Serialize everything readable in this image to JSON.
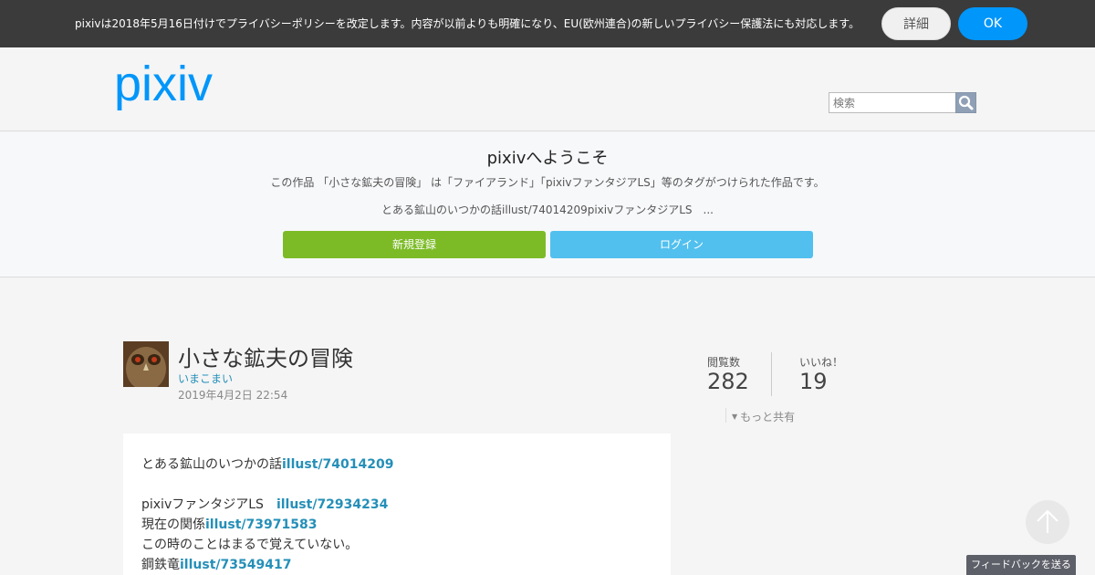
{
  "cookie_bar": {
    "text": "pixivは2018年5月16日付けでプライバシーポリシーを改定します。内容が以前よりも明確になり、EU(欧州連合)の新しいプライバシー保護法にも対応します。",
    "detail_label": "詳細",
    "ok_label": "OK"
  },
  "header": {
    "logo_text": "pixiv",
    "search_placeholder": "検索"
  },
  "welcome": {
    "title": "pixivへようこそ",
    "description": "この作品 「小さな鉱夫の冒険」 は「ファイアランド」「pixivファンタジアLS」等のタグがつけられた作品です。",
    "excerpt": "とある鉱山のいつかの話illust/74014209pixivファンタジアLS　...",
    "signup_label": "新規登録",
    "login_label": "ログイン"
  },
  "work": {
    "title": "小さな鉱夫の冒険",
    "author": "いまこまい",
    "posted": "2019年4月2日 22:54"
  },
  "stats": {
    "views_label": "閲覧数",
    "views_value": "282",
    "likes_label": "いいね！",
    "likes_value": "19",
    "share_more": "もっと共有"
  },
  "caption": {
    "line1_text": "とある鉱山のいつかの話",
    "line1_link": "illust/74014209",
    "line2_text": "pixivファンタジアLS　",
    "line2_link": "illust/72934234",
    "line3_text": "現在の関係",
    "line3_link": "illust/73971583",
    "line4_text": "この時のことはまるで覚えていない。",
    "line5_text": "鋼鉄竜",
    "line5_link": "illust/73549417"
  },
  "footer": {
    "feedback_label": "フィードバックを送る"
  },
  "colors": {
    "cookie_bg": "#3b3b3b",
    "ok_button": "#0096fa",
    "logo": "#0096fa",
    "signup": "#7cbb26",
    "login": "#51c0ee",
    "link": "#258fb8"
  },
  "icons": {
    "search": "search-icon",
    "scroll_top": "arrow-up-icon",
    "share_toggle": "triangle-down-icon"
  }
}
